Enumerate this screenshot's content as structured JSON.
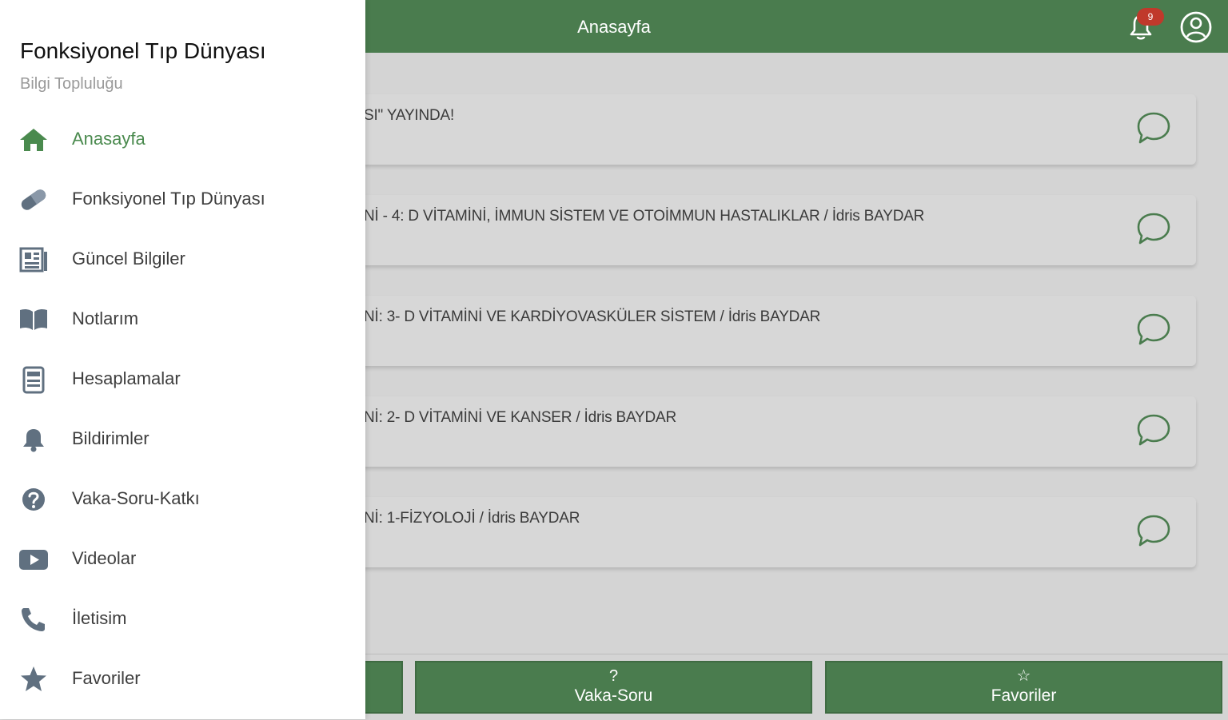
{
  "header": {
    "title": "Anasayfa",
    "notification_badge": "9"
  },
  "cards": [
    {
      "text": "SI\" YAYINDA!"
    },
    {
      "text": "Nİ - 4: D VİTAMİNİ, İMMUN SİSTEM VE OTOİMMUN HASTALIKLAR / İdris BAYDAR"
    },
    {
      "text": "Nİ: 3- D VİTAMİNİ VE KARDİYOVASKÜLER SİSTEM / İdris BAYDAR"
    },
    {
      "text": "Nİ: 2- D VİTAMİNİ VE KANSER / İdris BAYDAR"
    },
    {
      "text": "Nİ: 1-FİZYOLOJİ / İdris BAYDAR"
    }
  ],
  "tabs": [
    {
      "icon": "",
      "label": ""
    },
    {
      "icon": "?",
      "label": "Vaka-Soru"
    },
    {
      "icon": "☆",
      "label": "Favoriler"
    }
  ],
  "drawer": {
    "title": "Fonksiyonel Tıp Dünyası",
    "subtitle": "Bilgi Topluluğu",
    "items": [
      {
        "label": "Anasayfa",
        "icon": "home-icon"
      },
      {
        "label": "Fonksiyonel Tıp Dünyası",
        "icon": "pill-icon"
      },
      {
        "label": "Güncel Bilgiler",
        "icon": "newspaper-icon"
      },
      {
        "label": "Notlarım",
        "icon": "book-icon"
      },
      {
        "label": "Hesaplamalar",
        "icon": "calculator-icon"
      },
      {
        "label": "Bildirimler",
        "icon": "bell-icon"
      },
      {
        "label": "Vaka-Soru-Katkı",
        "icon": "help-circle-icon"
      },
      {
        "label": "Videolar",
        "icon": "video-icon"
      },
      {
        "label": "İletisim",
        "icon": "phone-icon"
      },
      {
        "label": "Favoriler",
        "icon": "star-icon"
      }
    ]
  },
  "colors": {
    "primary": "#4a7c4e",
    "active_text": "#4a8a4e",
    "drawer_icon": "#607080",
    "overlay": "#d4d4d4"
  }
}
